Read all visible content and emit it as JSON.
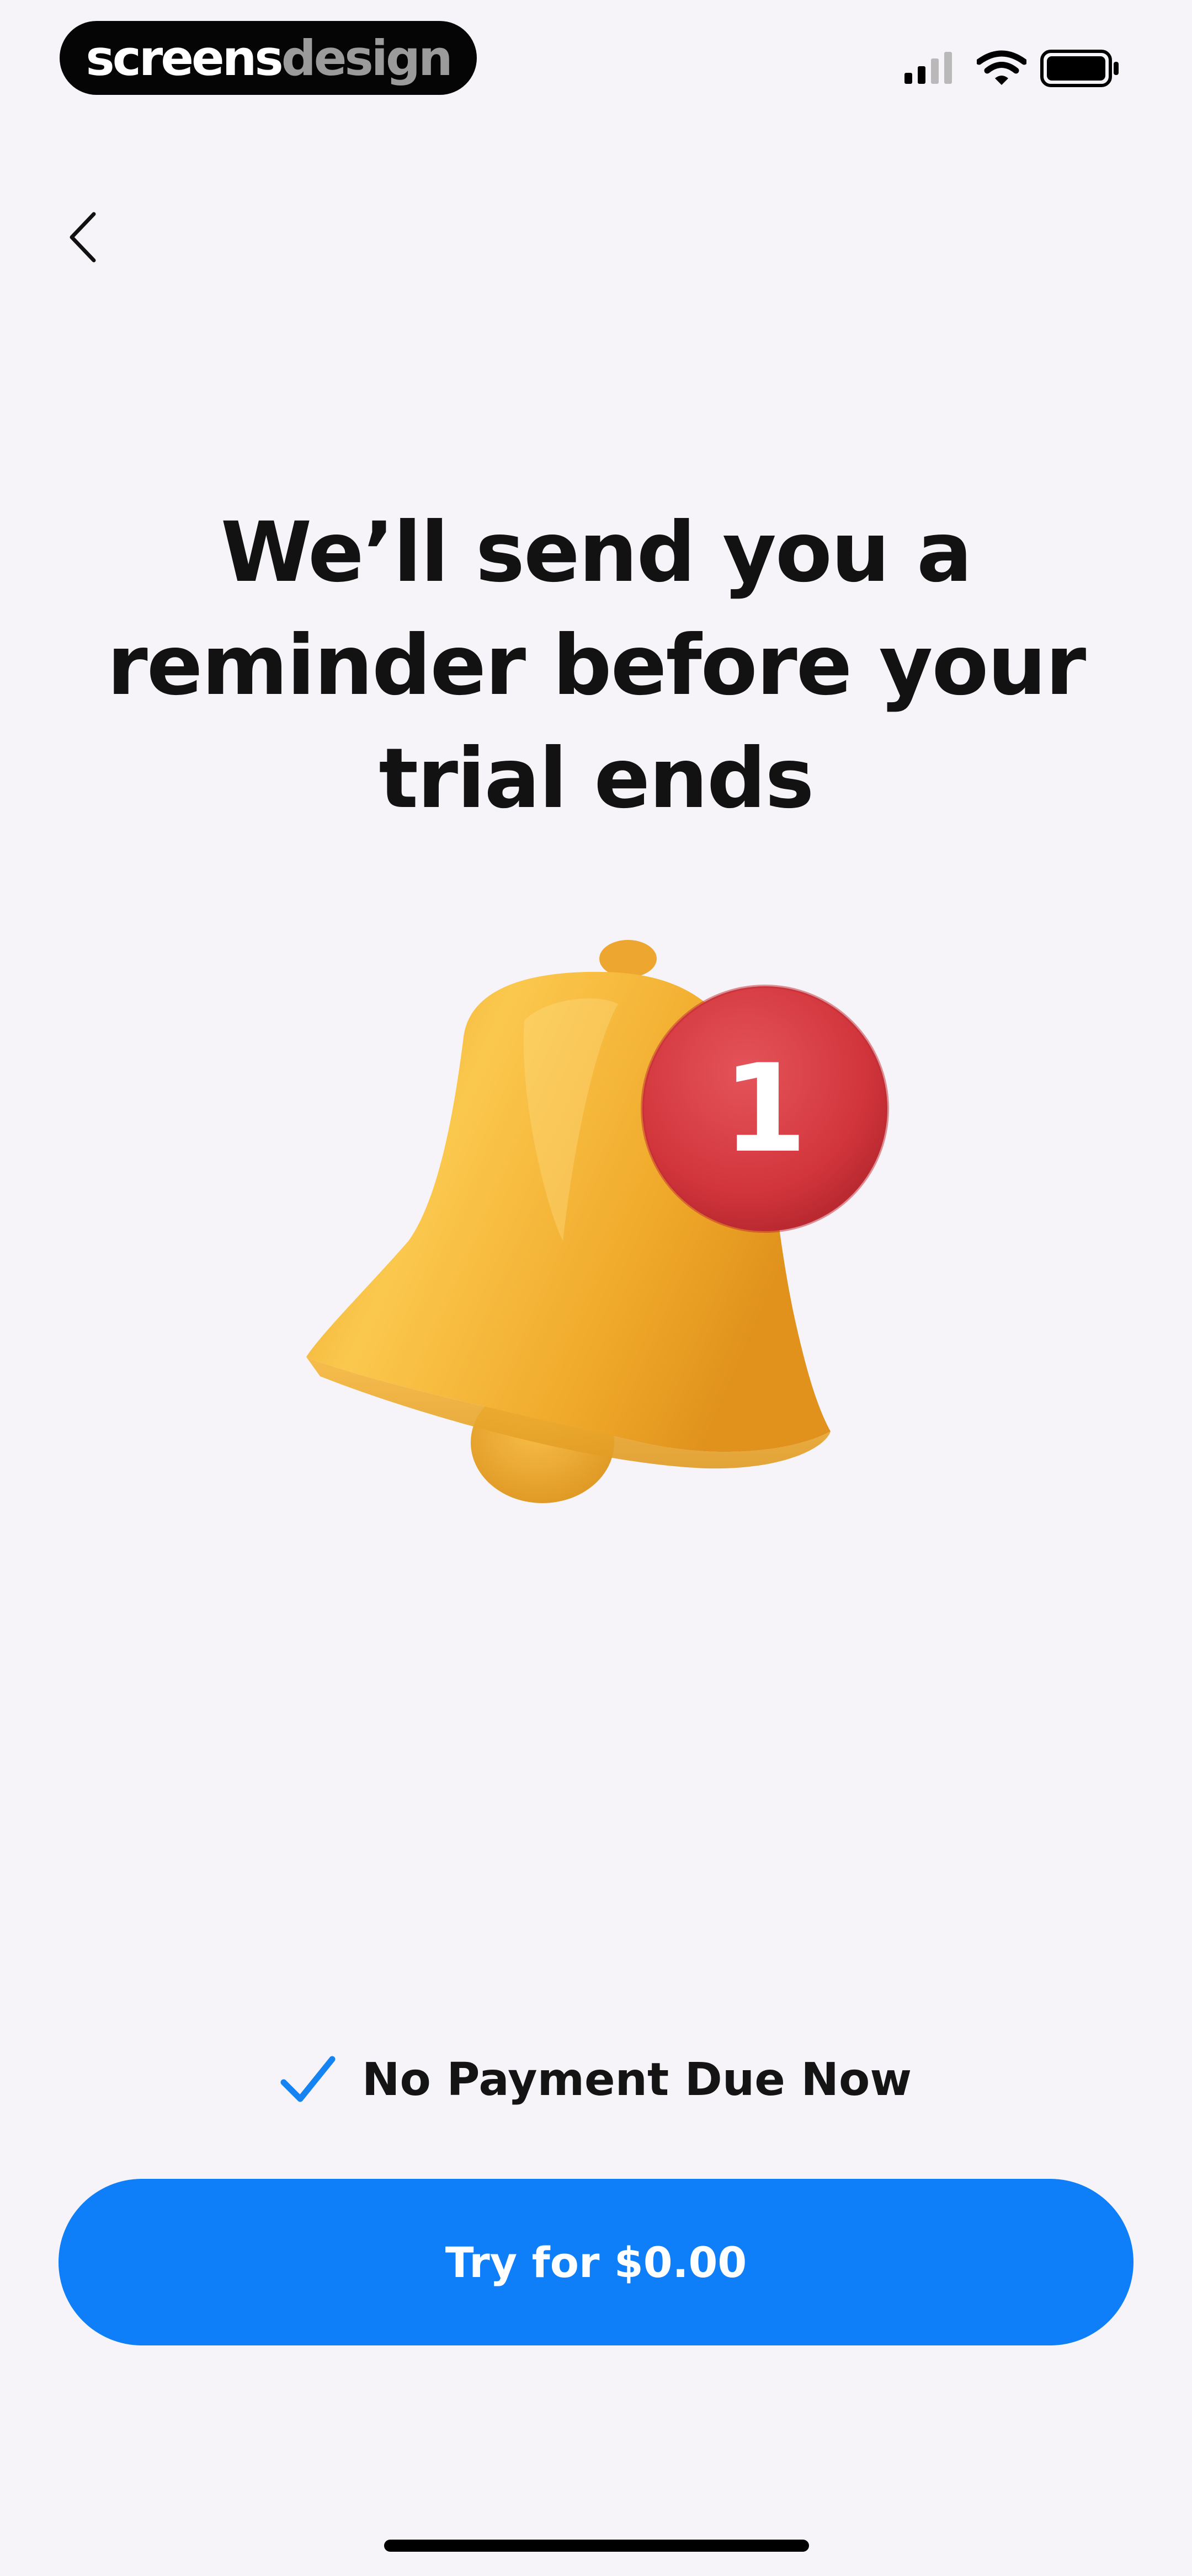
{
  "brand": {
    "part1": "screens",
    "part2": "design"
  },
  "status_bar": {
    "icons": [
      "cellular-signal-icon",
      "wifi-icon",
      "battery-icon"
    ]
  },
  "nav": {
    "back_icon": "chevron-left-icon"
  },
  "headline": {
    "line1": "We’ll send you a",
    "line2": "reminder before your",
    "line3": "trial ends"
  },
  "illustration": {
    "icon": "bell-icon",
    "badge_count": "1",
    "badge_color": "#d6343c",
    "bell_color": "#f5b43a"
  },
  "assurance": {
    "icon": "checkmark-icon",
    "text": "No Payment Due Now"
  },
  "cta": {
    "label": "Try for $0.00",
    "color": "#0e7ff8"
  }
}
